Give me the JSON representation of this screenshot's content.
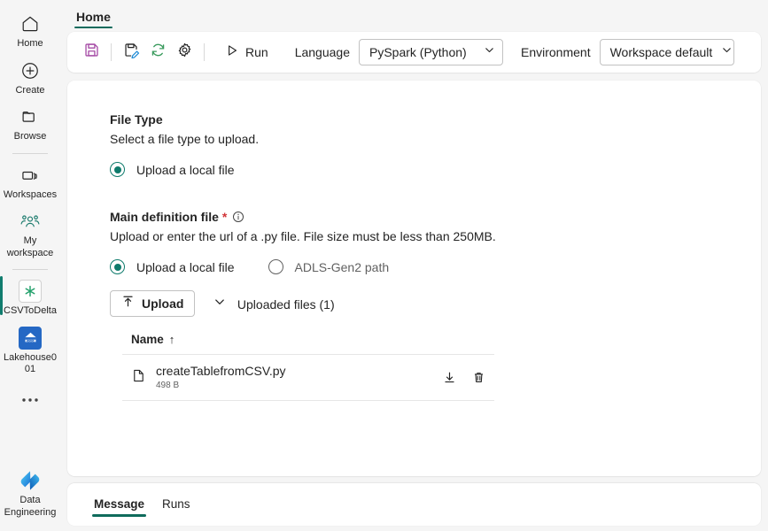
{
  "rail": {
    "items": [
      {
        "label": "Home",
        "icon": "home-icon",
        "active": false
      },
      {
        "label": "Create",
        "icon": "plus-circle-icon",
        "active": false
      },
      {
        "label": "Browse",
        "icon": "folder-icon",
        "active": false
      },
      {
        "label": "Workspaces",
        "icon": "workspaces-icon",
        "active": false
      },
      {
        "label": "My workspace",
        "icon": "people-icon",
        "active": false
      },
      {
        "label": "CSVToDelta",
        "icon": "spark-job-definition-icon",
        "active": true
      },
      {
        "label": "Lakehouse001",
        "icon": "lakehouse-icon",
        "active": false
      }
    ],
    "more_label": "More options",
    "footer": {
      "label": "Data Engineering",
      "icon": "data-engineering-icon"
    }
  },
  "tabstrip": {
    "tabs": [
      {
        "label": "Home",
        "active": true
      }
    ]
  },
  "toolbar": {
    "save_label": "Save",
    "edit_label": "Edit",
    "refresh_label": "Refresh",
    "settings_label": "Settings",
    "run_label": "Run",
    "language_label": "Language",
    "language_value": "PySpark (Python)",
    "environment_label": "Environment",
    "environment_value": "Workspace default"
  },
  "form": {
    "file_type": {
      "title": "File Type",
      "description": "Select a file type to upload.",
      "options": [
        {
          "label": "Upload a local file",
          "checked": true
        }
      ]
    },
    "main_definition_file": {
      "title": "Main definition file",
      "required_mark": "*",
      "info_icon": "info-icon",
      "description": "Upload or enter the url of a .py file. File size must be less than 250MB.",
      "options": [
        {
          "label": "Upload a local file",
          "checked": true
        },
        {
          "label": "ADLS-Gen2 path",
          "checked": false
        }
      ],
      "upload_button_label": "Upload",
      "disclosure_label": "Uploaded files (1)",
      "table": {
        "columns": [
          {
            "label": "Name",
            "sort": "↑"
          }
        ],
        "rows": [
          {
            "name": "createTablefromCSV.py",
            "size": "498 B",
            "file_icon": "file-icon",
            "download_label": "Download",
            "delete_label": "Delete"
          }
        ]
      }
    }
  },
  "bottom_panel": {
    "tabs": [
      {
        "label": "Message",
        "active": true
      },
      {
        "label": "Runs",
        "active": false
      }
    ]
  },
  "colors": {
    "accent_teal": "#0f7b6c",
    "tab_underline": "#0f6b5c",
    "save_purple": "#a64ca6",
    "refresh_green": "#3b9b5e",
    "pencil_blue": "#1f8bd6",
    "required_red": "#d13438",
    "lakehouse_blue": "#2568c4",
    "canvas_gray": "#f5f5f5"
  }
}
